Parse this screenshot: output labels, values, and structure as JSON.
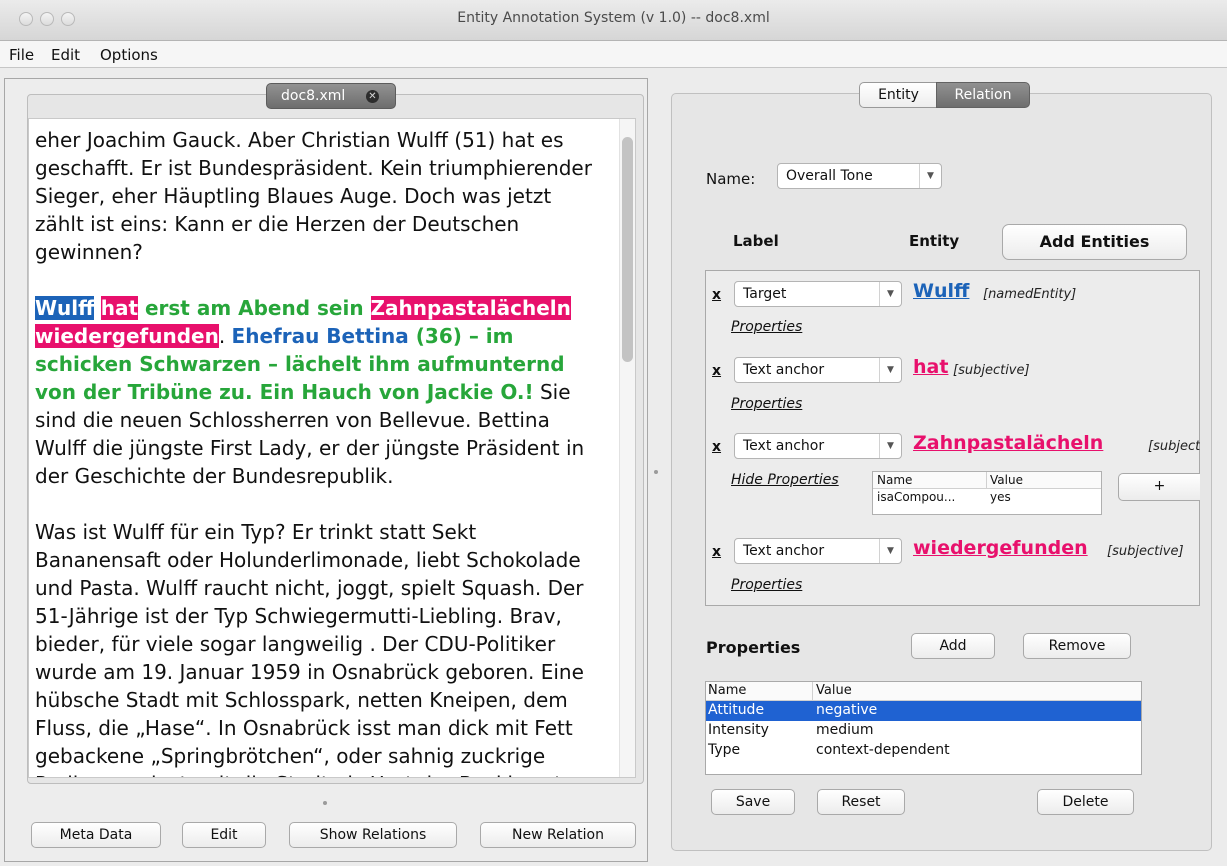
{
  "window": {
    "title": "Entity Annotation System (v 1.0) -- doc8.xml"
  },
  "menu": [
    "File",
    "Edit",
    "Options"
  ],
  "document_tab": {
    "label": "doc8.xml",
    "close_glyph": "x"
  },
  "document": {
    "p1": "eher Joachim Gauck. Aber Christian Wulff (51) hat es geschafft. Er ist Bundespräsident. Kein triumphierender Sieger, eher Häuptling Blaues Auge. Doch was jetzt zählt ist eins: Kann er die Herzen der Deutschen gewinnen?",
    "p2": {
      "s1": "Wulff",
      "s2": " ",
      "s3": "hat",
      "s4": " erst am Abend sein ",
      "s5": "Zahnpastalächeln wiedergefunden",
      "s6": ". ",
      "s7": "Ehefrau Bettina",
      "s8": " (36) – im schicken Schwarzen – lächelt ihm aufmunternd von der Tribüne zu. Ein Hauch von Jackie O.!",
      "s9": " Sie sind die neuen Schlossherren von Bellevue. Bettina Wulff die jüngste First Lady, er der jüngste Präsident in der Geschichte der Bundesrepublik."
    },
    "p3": "Was ist Wulff für ein Typ? Er trinkt statt Sekt Bananensaft oder Holunderlimonade, liebt Schokolade und Pasta. Wulff raucht nicht, joggt, spielt Squash. Der 51-Jährige ist der Typ Schwiegermutti-Liebling. Brav, bieder, für viele sogar langweilig . Der CDU-Politiker wurde am 19. Januar 1959 in Osnabrück geboren. Eine hübsche Stadt mit Schlosspark, netten Kneipen, dem Fluss, die „Hase“. In Osnabrück isst man dick mit Fett gebackene „Springbrötchen“, oder sahnig zuckrige Pralinen – einst galt die Stadt als Hort der Backkunst."
  },
  "left_buttons": {
    "meta": "Meta Data",
    "edit": "Edit",
    "show_relations": "Show Relations",
    "new_relation": "New Relation"
  },
  "tabs": {
    "entity": "Entity",
    "relation": "Relation",
    "selected": "Relation"
  },
  "relation": {
    "name_label": "Name:",
    "name_value": "Overall Tone",
    "label_header": "Label",
    "entity_header": "Entity",
    "add_entities": "Add Entities",
    "entries": [
      {
        "x": "x",
        "label": "Target",
        "entity": "Wulff",
        "type": "[namedEntity]",
        "props": "Properties"
      },
      {
        "x": "x",
        "label": "Text anchor",
        "entity": "hat",
        "type": "[subjective]",
        "props": "Properties"
      },
      {
        "x": "x",
        "label": "Text anchor",
        "entity": "Zahnpastalächeln",
        "type": "[subjectiv",
        "props": "Hide Properties"
      },
      {
        "x": "x",
        "label": "Text anchor",
        "entity": "wiedergefunden",
        "type": "[subjective]",
        "props": "Properties"
      }
    ],
    "mini_table": {
      "headers": [
        "Name",
        "Value"
      ],
      "rows": [
        [
          "isaCompou...",
          "yes"
        ]
      ],
      "plus": "+"
    },
    "properties_title": "Properties",
    "add": "Add",
    "remove": "Remove",
    "prop_table": {
      "headers": [
        "Name",
        "Value"
      ],
      "rows": [
        [
          "Attitude",
          "negative"
        ],
        [
          "Intensity",
          "medium"
        ],
        [
          "Type",
          "context-dependent"
        ]
      ],
      "selected_row": "Attitude"
    },
    "save": "Save",
    "reset": "Reset",
    "delete": "Delete"
  },
  "colors": {
    "entity_blue": "#1c63b8",
    "subjective_pink": "#e8106c",
    "sentence_green": "#27a63a",
    "selection_blue": "#1f62d2"
  }
}
